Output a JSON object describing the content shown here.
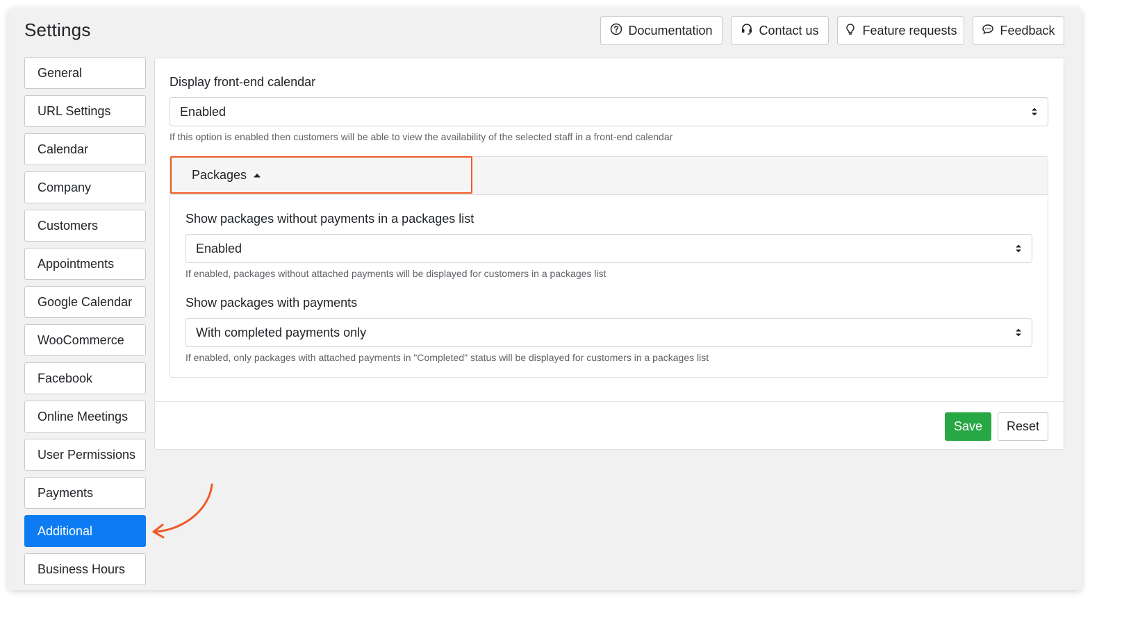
{
  "page": {
    "title": "Settings"
  },
  "header_buttons": [
    {
      "label": "Documentation",
      "icon": "question-circle-icon"
    },
    {
      "label": "Contact us",
      "icon": "headset-icon"
    },
    {
      "label": "Feature requests",
      "icon": "lightbulb-icon"
    },
    {
      "label": "Feedback",
      "icon": "chat-bubble-icon"
    }
  ],
  "sidebar": {
    "items": [
      {
        "label": "General"
      },
      {
        "label": "URL Settings"
      },
      {
        "label": "Calendar"
      },
      {
        "label": "Company"
      },
      {
        "label": "Customers"
      },
      {
        "label": "Appointments"
      },
      {
        "label": "Google Calendar"
      },
      {
        "label": "WooCommerce"
      },
      {
        "label": "Facebook"
      },
      {
        "label": "Online Meetings"
      },
      {
        "label": "User Permissions"
      },
      {
        "label": "Payments"
      },
      {
        "label": "Additional"
      },
      {
        "label": "Business Hours"
      }
    ],
    "active": "Additional"
  },
  "form": {
    "frontend_calendar": {
      "label": "Display front-end calendar",
      "value": "Enabled",
      "help": "If this option is enabled then customers will be able to view the availability of the selected staff in a front-end calendar"
    },
    "packages": {
      "toggle_label": "Packages",
      "expanded": true,
      "without_payments": {
        "label": "Show packages without payments in a packages list",
        "value": "Enabled",
        "help": "If enabled, packages without attached payments will be displayed for customers in a packages list"
      },
      "with_payments": {
        "label": "Show packages with payments",
        "value": "With completed payments only",
        "help": "If enabled, only packages with attached payments in \"Completed\" status will be displayed for customers in a packages list"
      }
    }
  },
  "actions": {
    "save_label": "Save",
    "reset_label": "Reset"
  },
  "colors": {
    "primary": "#0d7cf2",
    "success": "#28a745",
    "highlight": "#ef5a24"
  }
}
